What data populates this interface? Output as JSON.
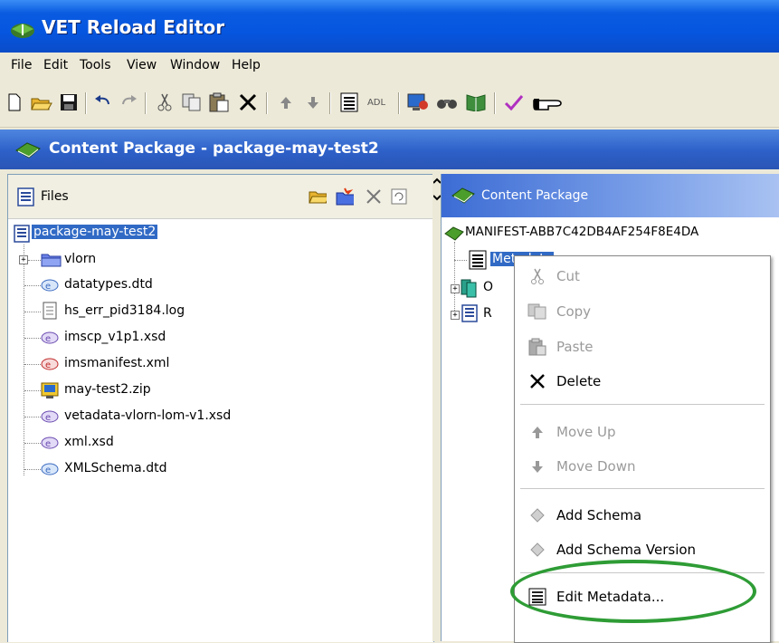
{
  "window": {
    "title": "VET Reload Editor",
    "icon": "book-icon"
  },
  "menubar": {
    "items": [
      "File",
      "Edit",
      "Tools",
      "View",
      "Window",
      "Help"
    ]
  },
  "toolbar": {
    "icons": [
      "new-document-icon",
      "open-folder-icon",
      "save-icon",
      "undo-icon",
      "redo-icon",
      "cut-icon",
      "copy-icon",
      "paste-icon",
      "delete-icon",
      "move-up-icon",
      "move-down-icon",
      "metadata-icon",
      "adl-icon",
      "monitor-icon",
      "binoculars-icon",
      "book-icon",
      "checkmark-icon",
      "pointing-hand-icon"
    ],
    "adl_label": "ADL"
  },
  "document": {
    "title": "Content Package - package-may-test2"
  },
  "files_pane": {
    "title": "Files",
    "root": "package-may-test2",
    "items": [
      {
        "label": "vlorn",
        "icon": "folder-icon"
      },
      {
        "label": "datatypes.dtd",
        "icon": "xml-file-icon"
      },
      {
        "label": "hs_err_pid3184.log",
        "icon": "text-file-icon"
      },
      {
        "label": "imscp_v1p1.xsd",
        "icon": "xml-file-icon"
      },
      {
        "label": "imsmanifest.xml",
        "icon": "xml-file-icon"
      },
      {
        "label": "may-test2.zip",
        "icon": "zip-file-icon"
      },
      {
        "label": "vetadata-vlorn-lom-v1.xsd",
        "icon": "xml-file-icon"
      },
      {
        "label": "xml.xsd",
        "icon": "xml-file-icon"
      },
      {
        "label": "XMLSchema.dtd",
        "icon": "xml-file-icon"
      }
    ]
  },
  "content_pane": {
    "title": "Content Package",
    "manifest": "MANIFEST-ABB7C42DB4AF254F8E4DA",
    "children": [
      {
        "label": "Metadata",
        "selected": true
      },
      {
        "label": "O"
      },
      {
        "label": "R"
      }
    ]
  },
  "context_menu": {
    "items": [
      {
        "label": "Cut",
        "enabled": false,
        "icon": "cut-icon"
      },
      {
        "label": "Copy",
        "enabled": false,
        "icon": "copy-icon"
      },
      {
        "label": "Paste",
        "enabled": false,
        "icon": "paste-icon"
      },
      {
        "label": "Delete",
        "enabled": true,
        "icon": "delete-icon"
      },
      {
        "label": "Move Up",
        "enabled": false,
        "icon": "move-up-icon"
      },
      {
        "label": "Move Down",
        "enabled": false,
        "icon": "move-down-icon"
      },
      {
        "label": "Add Schema",
        "enabled": true,
        "icon": "diamond-icon"
      },
      {
        "label": "Add Schema Version",
        "enabled": true,
        "icon": "diamond-icon"
      },
      {
        "label": "Edit Metadata...",
        "enabled": true,
        "icon": "metadata-icon",
        "highlighted_by_annotation": true
      }
    ]
  },
  "colors": {
    "title_blue": "#0656E0",
    "selection": "#316AC5",
    "annotation_green": "#2E9C35"
  }
}
